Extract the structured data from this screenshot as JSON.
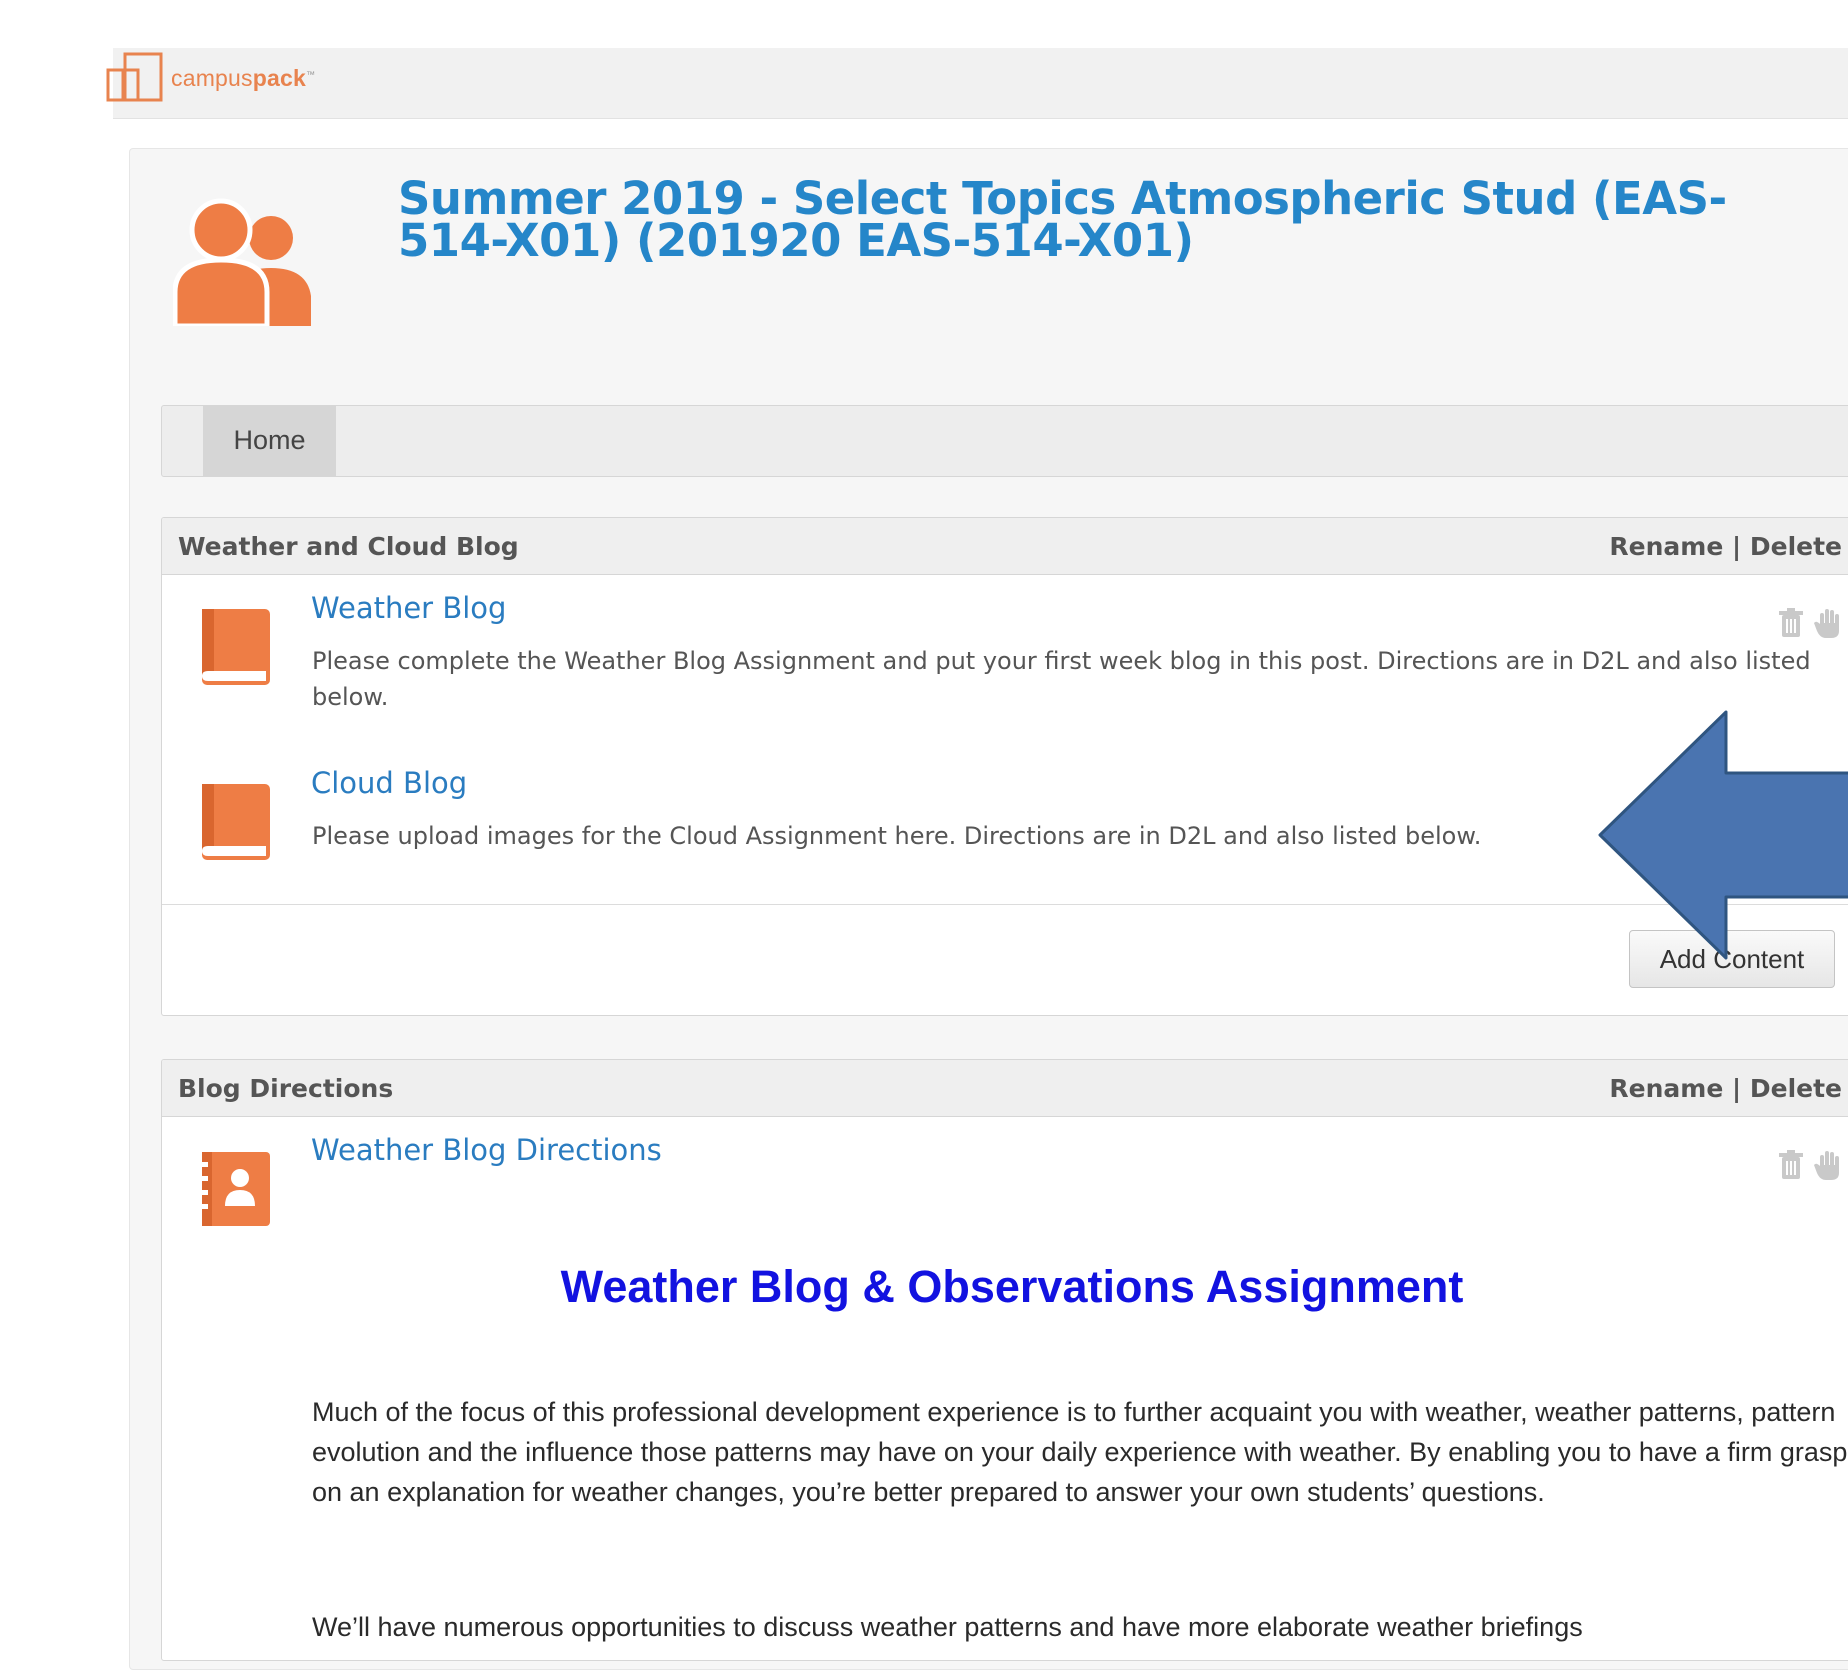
{
  "brand": {
    "name_prefix": "campus",
    "name_bold": "pack",
    "tm": "™"
  },
  "course": {
    "title": "Summer 2019 - Select Topics Atmospheric Stud (EAS-514-X01) (201920 EAS-514-X01)"
  },
  "tabs": [
    {
      "label": "Home"
    }
  ],
  "panels": [
    {
      "title": "Weather and Cloud Blog",
      "rename_label": "Rename",
      "separator": "|",
      "delete_label": "Delete",
      "items": [
        {
          "icon": "book-icon",
          "title": "Weather Blog",
          "description": "Please complete the Weather Blog Assignment and put your first week blog in this post. Directions are in D2L and also listed below."
        },
        {
          "icon": "book-icon",
          "title": "Cloud Blog",
          "description": "Please upload images for the Cloud Assignment here. Directions are in D2L and also listed below."
        }
      ],
      "add_button": "Add Content"
    },
    {
      "title": "Blog Directions",
      "rename_label": "Rename",
      "separator": "|",
      "delete_label": "Delete",
      "items": [
        {
          "icon": "contact-book-icon",
          "title": "Weather Blog Directions"
        }
      ],
      "content_heading": "Weather Blog & Observations Assignment",
      "paragraphs": [
        "Much of the focus of this professional development experience is to further acquaint you with weather, weather patterns, pattern evolution and the influence those patterns may have on your daily experience with weather. By enabling you to have a firm grasp on an explanation for weather changes, you’re better prepared to answer your own students’ questions.",
        "We’ll have numerous opportunities to discuss weather patterns and have more elaborate weather briefings"
      ]
    }
  ],
  "colors": {
    "accent": "#2586c9",
    "icon": "#ee7d45",
    "arrow": "#4a74b0",
    "heading": "#1212e0"
  }
}
